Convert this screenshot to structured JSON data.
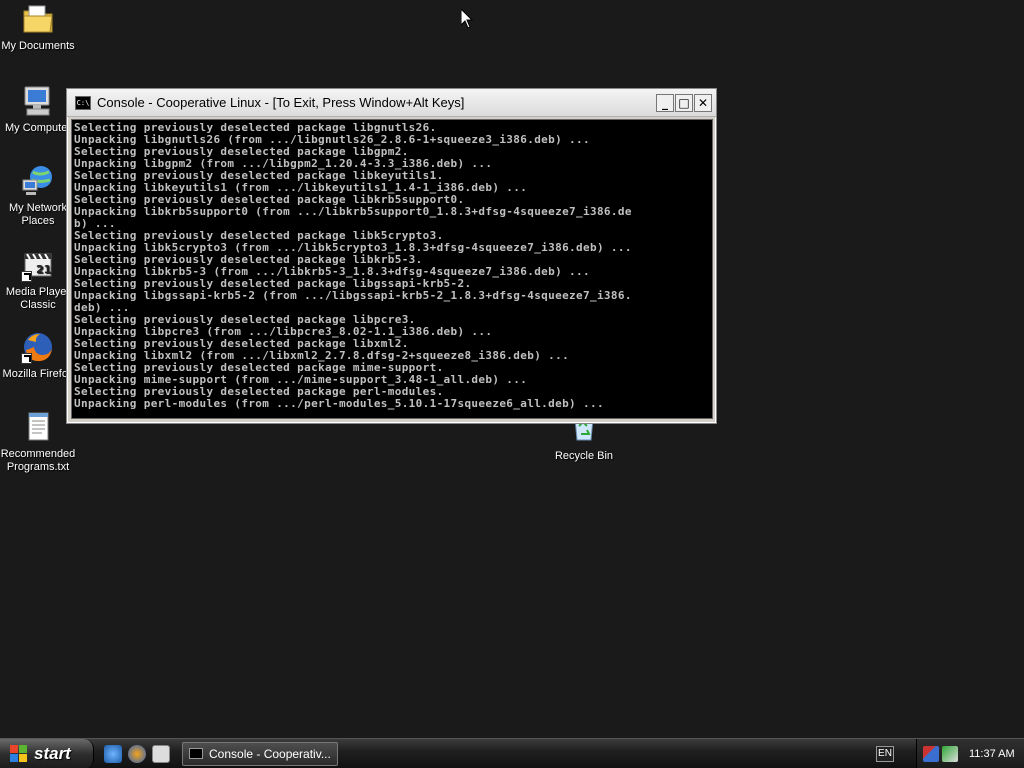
{
  "desktop": {
    "icons": [
      {
        "label_lines": [
          "My Documents"
        ],
        "icon": "folder-icon"
      },
      {
        "label_lines": [
          "My Computer"
        ],
        "icon": "computer-icon"
      },
      {
        "label_lines": [
          "My Network",
          "Places"
        ],
        "icon": "network-icon"
      },
      {
        "label_lines": [
          "Media Player",
          "Classic"
        ],
        "icon": "media-player-icon"
      },
      {
        "label_lines": [
          "Mozilla Firefox"
        ],
        "icon": "firefox-icon"
      },
      {
        "label_lines": [
          "Recommended",
          "Programs.txt"
        ],
        "icon": "text-file-icon"
      },
      {
        "label_lines": [
          "Recycle Bin"
        ],
        "icon": "recycle-bin-icon"
      }
    ]
  },
  "window": {
    "title": "Console - Cooperative Linux - [To Exit, Press Window+Alt Keys]",
    "icon_text": "C:\\",
    "buttons": {
      "minimize": "_",
      "maximize": "□",
      "close": "✕"
    },
    "console_lines": [
      "Selecting previously deselected package libgnutls26.",
      "Unpacking libgnutls26 (from .../libgnutls26_2.8.6-1+squeeze3_i386.deb) ...",
      "Selecting previously deselected package libgpm2.",
      "Unpacking libgpm2 (from .../libgpm2_1.20.4-3.3_i386.deb) ...",
      "Selecting previously deselected package libkeyutils1.",
      "Unpacking libkeyutils1 (from .../libkeyutils1_1.4-1_i386.deb) ...",
      "Selecting previously deselected package libkrb5support0.",
      "Unpacking libkrb5support0 (from .../libkrb5support0_1.8.3+dfsg-4squeeze7_i386.de",
      "b) ...",
      "Selecting previously deselected package libk5crypto3.",
      "Unpacking libk5crypto3 (from .../libk5crypto3_1.8.3+dfsg-4squeeze7_i386.deb) ...",
      "Selecting previously deselected package libkrb5-3.",
      "Unpacking libkrb5-3 (from .../libkrb5-3_1.8.3+dfsg-4squeeze7_i386.deb) ...",
      "Selecting previously deselected package libgssapi-krb5-2.",
      "Unpacking libgssapi-krb5-2 (from .../libgssapi-krb5-2_1.8.3+dfsg-4squeeze7_i386.",
      "deb) ...",
      "Selecting previously deselected package libpcre3.",
      "Unpacking libpcre3 (from .../libpcre3_8.02-1.1_i386.deb) ...",
      "Selecting previously deselected package libxml2.",
      "Unpacking libxml2 (from .../libxml2_2.7.8.dfsg-2+squeeze8_i386.deb) ...",
      "Selecting previously deselected package mime-support.",
      "Unpacking mime-support (from .../mime-support_3.48-1_all.deb) ...",
      "Selecting previously deselected package perl-modules.",
      "Unpacking perl-modules (from .../perl-modules_5.10.1-17squeeze6_all.deb) ..."
    ]
  },
  "taskbar": {
    "start_label": "start",
    "quicklaunch": [
      "ie-icon",
      "firefox-icon",
      "media-player-icon"
    ],
    "task_button_label": "Console - Cooperativ...",
    "language": "EN",
    "clock": "11:37 AM"
  }
}
